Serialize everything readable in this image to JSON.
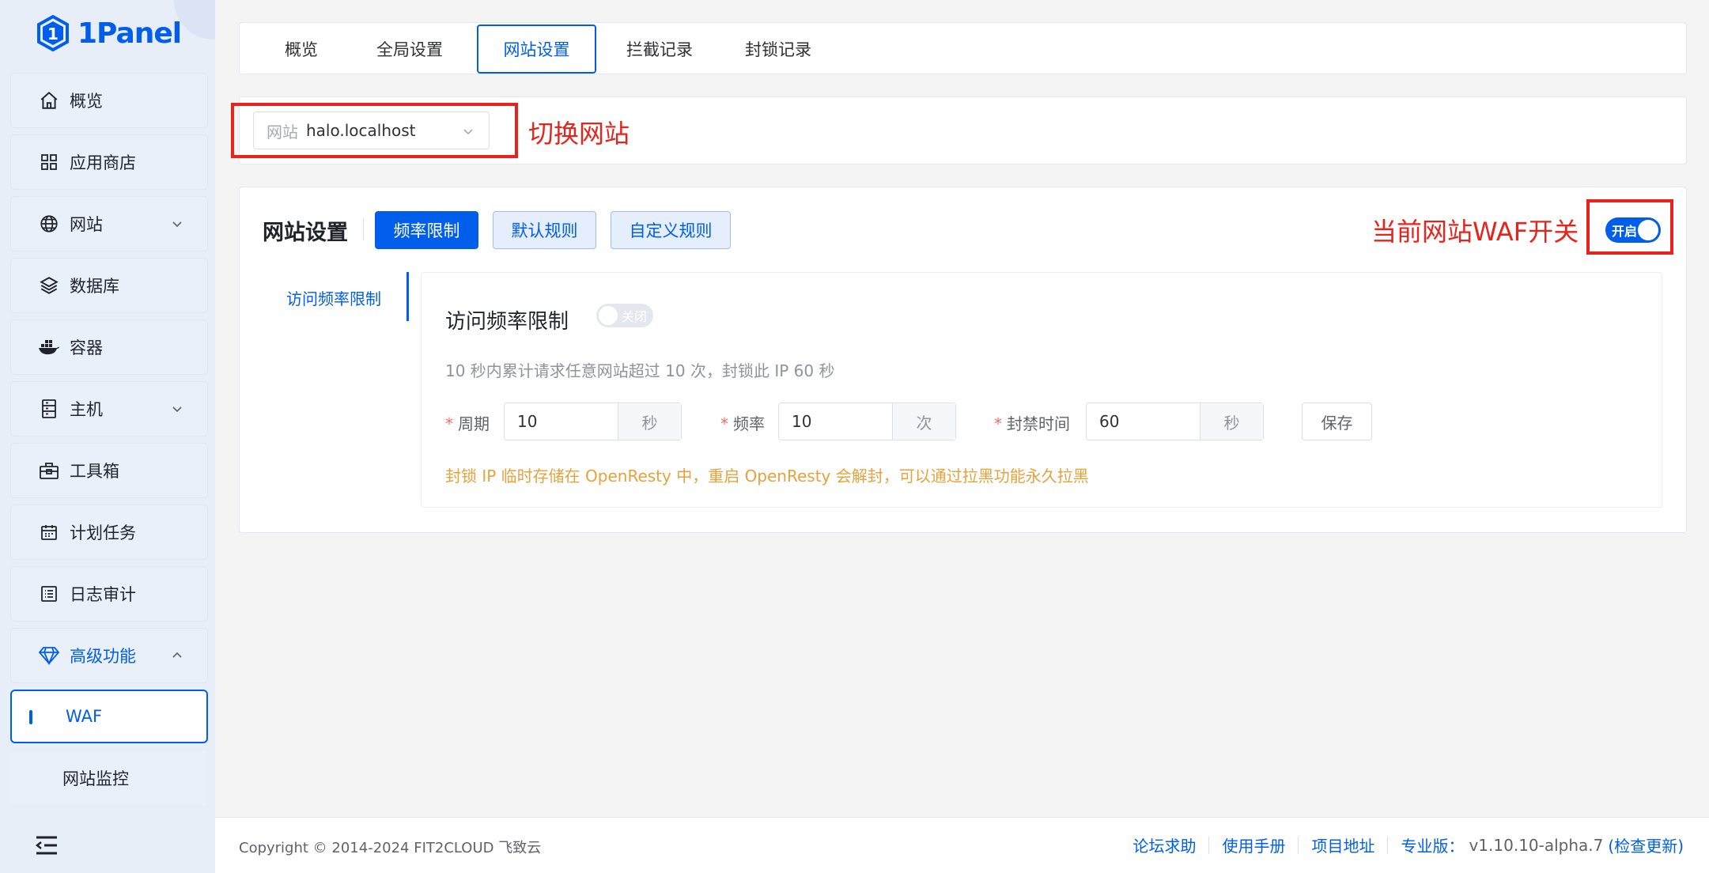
{
  "app": {
    "logo_text": "1Panel"
  },
  "sidebar": {
    "items": [
      {
        "label": "概览",
        "icon": "home-icon"
      },
      {
        "label": "应用商店",
        "icon": "grid-icon"
      },
      {
        "label": "网站",
        "icon": "globe-icon",
        "expandable": true
      },
      {
        "label": "数据库",
        "icon": "layers-icon"
      },
      {
        "label": "容器",
        "icon": "docker-icon"
      },
      {
        "label": "主机",
        "icon": "server-icon",
        "expandable": true
      },
      {
        "label": "工具箱",
        "icon": "toolbox-icon"
      },
      {
        "label": "计划任务",
        "icon": "calendar-icon"
      },
      {
        "label": "日志审计",
        "icon": "log-icon"
      }
    ],
    "advanced": {
      "label": "高级功能",
      "icon": "diamond-icon"
    },
    "submenu": [
      {
        "label": "WAF",
        "active": true
      },
      {
        "label": "网站监控",
        "active": false
      }
    ]
  },
  "tabs": [
    {
      "label": "概览"
    },
    {
      "label": "全局设置"
    },
    {
      "label": "网站设置",
      "active": true
    },
    {
      "label": "拦截记录"
    },
    {
      "label": "封锁记录"
    }
  ],
  "site_select": {
    "prefix": "网站",
    "value": "halo.localhost"
  },
  "annotations": {
    "switch_site": "切换网站",
    "waf_switch": "当前网站WAF开关"
  },
  "main": {
    "title": "网站设置",
    "buttons": {
      "rate_limit": "频率限制",
      "default_rules": "默认规则",
      "custom_rules": "自定义规则"
    },
    "waf_switch_text": "开启",
    "subnav": "访问频率限制",
    "panel": {
      "title": "访问频率限制",
      "switch_text": "关闭",
      "description": "10 秒内累计请求任意网站超过 10 次，封锁此 IP 60 秒",
      "fields": {
        "period": {
          "label": "周期",
          "value": "10",
          "unit": "秒"
        },
        "frequency": {
          "label": "频率",
          "value": "10",
          "unit": "次"
        },
        "ban_time": {
          "label": "封禁时间",
          "value": "60",
          "unit": "秒"
        }
      },
      "save_label": "保存",
      "warning": "封锁 IP 临时存储在 OpenResty 中，重启 OpenResty 会解封，可以通过拉黑功能永久拉黑"
    }
  },
  "footer": {
    "copyright": "Copyright © 2014-2024 FIT2CLOUD 飞致云",
    "links": [
      "论坛求助",
      "使用手册",
      "项目地址"
    ],
    "version_label": "专业版：",
    "version": "v1.10.10-alpha.7",
    "check_update": "(检查更新)"
  },
  "colors": {
    "primary": "#005eeb",
    "annotation": "#e8231b",
    "warning": "#e6a23c"
  }
}
